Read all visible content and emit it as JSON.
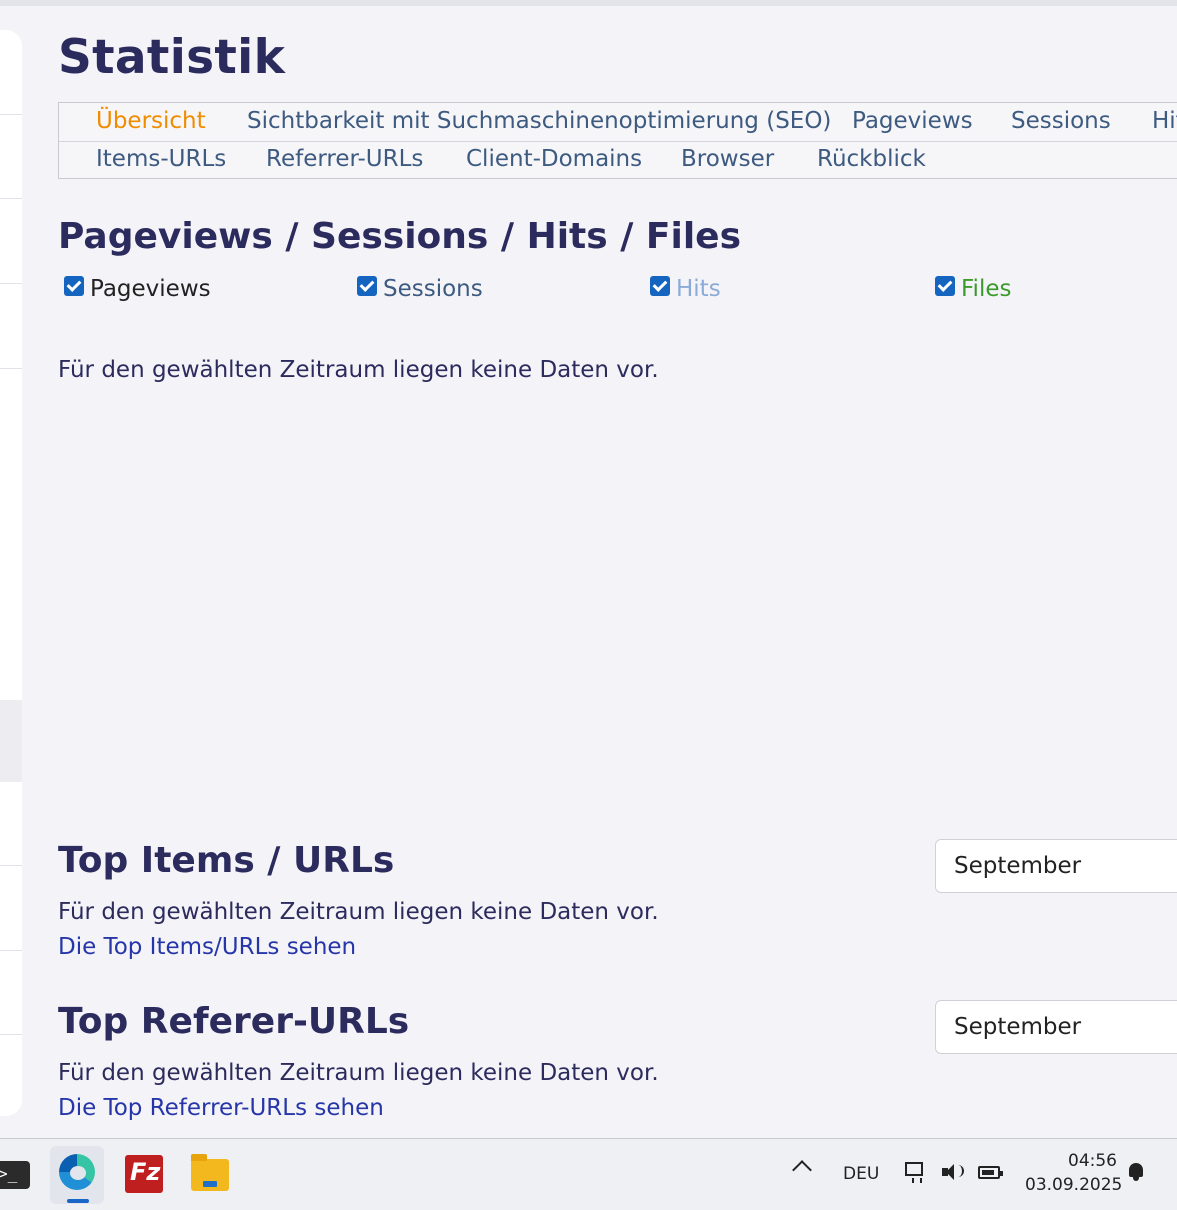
{
  "page": {
    "title": "Statistik"
  },
  "tabs": {
    "row1": [
      "Übersicht",
      "Sichtbarkeit mit Suchmaschinenoptimierung (SEO)",
      "Pageviews",
      "Sessions",
      "Hits"
    ],
    "row2": [
      "Items-URLs",
      "Referrer-URLs",
      "Client-Domains",
      "Browser",
      "Rückblick"
    ],
    "active": "Übersicht"
  },
  "chart_section": {
    "title": "Pageviews / Sessions / Hits / Files",
    "series": [
      {
        "label": "Pageviews",
        "checked": true,
        "color": "#222222"
      },
      {
        "label": "Sessions",
        "checked": true,
        "color": "#3d5a80"
      },
      {
        "label": "Hits",
        "checked": true,
        "color": "#8aaad8"
      },
      {
        "label": "Files",
        "checked": true,
        "color": "#3a9a2a"
      }
    ],
    "empty_message": "Für den gewählten Zeitraum liegen keine Daten vor."
  },
  "top_items": {
    "title": "Top Items / URLs",
    "month_select": "September",
    "empty_message": "Für den gewählten Zeitraum liegen keine Daten vor.",
    "link": "Die Top Items/URLs sehen"
  },
  "top_referrers": {
    "title": "Top Referer-URLs",
    "month_select": "September",
    "empty_message": "Für den gewählten Zeitraum liegen keine Daten vor.",
    "link": "Die Top Referrer-URLs sehen"
  },
  "taskbar": {
    "apps": [
      "terminal-icon",
      "edge-icon",
      "filezilla-icon",
      "file-explorer-icon"
    ],
    "terminal_glyph": ">_",
    "filezilla_glyph": "Fz",
    "language": "DEU",
    "time": "04:56",
    "date": "03.09.2025"
  },
  "colors": {
    "heading": "#2c2b5e",
    "tab_text": "#3d5a80",
    "tab_active": "#f08c00",
    "link": "#2636a8",
    "checkbox": "#1565c0"
  }
}
